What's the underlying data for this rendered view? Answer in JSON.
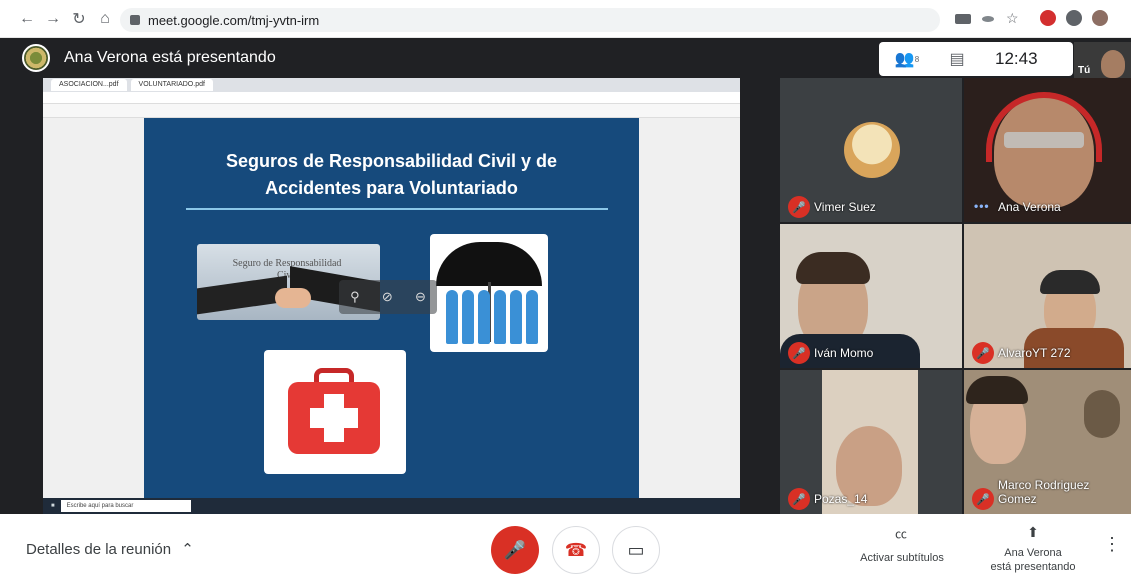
{
  "browser": {
    "url": "meet.google.com/tmj-yvtn-irm"
  },
  "meet": {
    "presenter_banner": "Ana Verona está presentando",
    "participants_badge": "8",
    "clock": "12:43",
    "self_label": "Tú"
  },
  "presentation": {
    "tab1": "ASOCIACION...pdf",
    "tab2": "VOLUNTARIADO.pdf",
    "slide_title_line1": "Seguros de Responsabilidad Civil y de",
    "slide_title_line2": "Accidentes para Voluntariado",
    "image_caption": "Seguro de Responsabilidad Civil",
    "taskbar_search": "Escribe aquí para buscar"
  },
  "participants": [
    {
      "name": "Vimer Suez",
      "muted": true
    },
    {
      "name": "Ana Verona",
      "muted": false,
      "speaking": true
    },
    {
      "name": "Iván Momo",
      "muted": true
    },
    {
      "name": "AlvaroYT 272",
      "muted": true
    },
    {
      "name": "Pozas_14",
      "muted": true
    },
    {
      "name": "Marco Rodriguez Gomez",
      "muted": true
    }
  ],
  "bottombar": {
    "details": "Detalles de la reunión",
    "captions": "Activar subtítulos",
    "presenting_line1": "Ana Verona",
    "presenting_line2": "está presentando"
  },
  "colors": {
    "end_call": "#d93025",
    "slide_bg": "#164a7c",
    "meet_bg": "#202124"
  }
}
